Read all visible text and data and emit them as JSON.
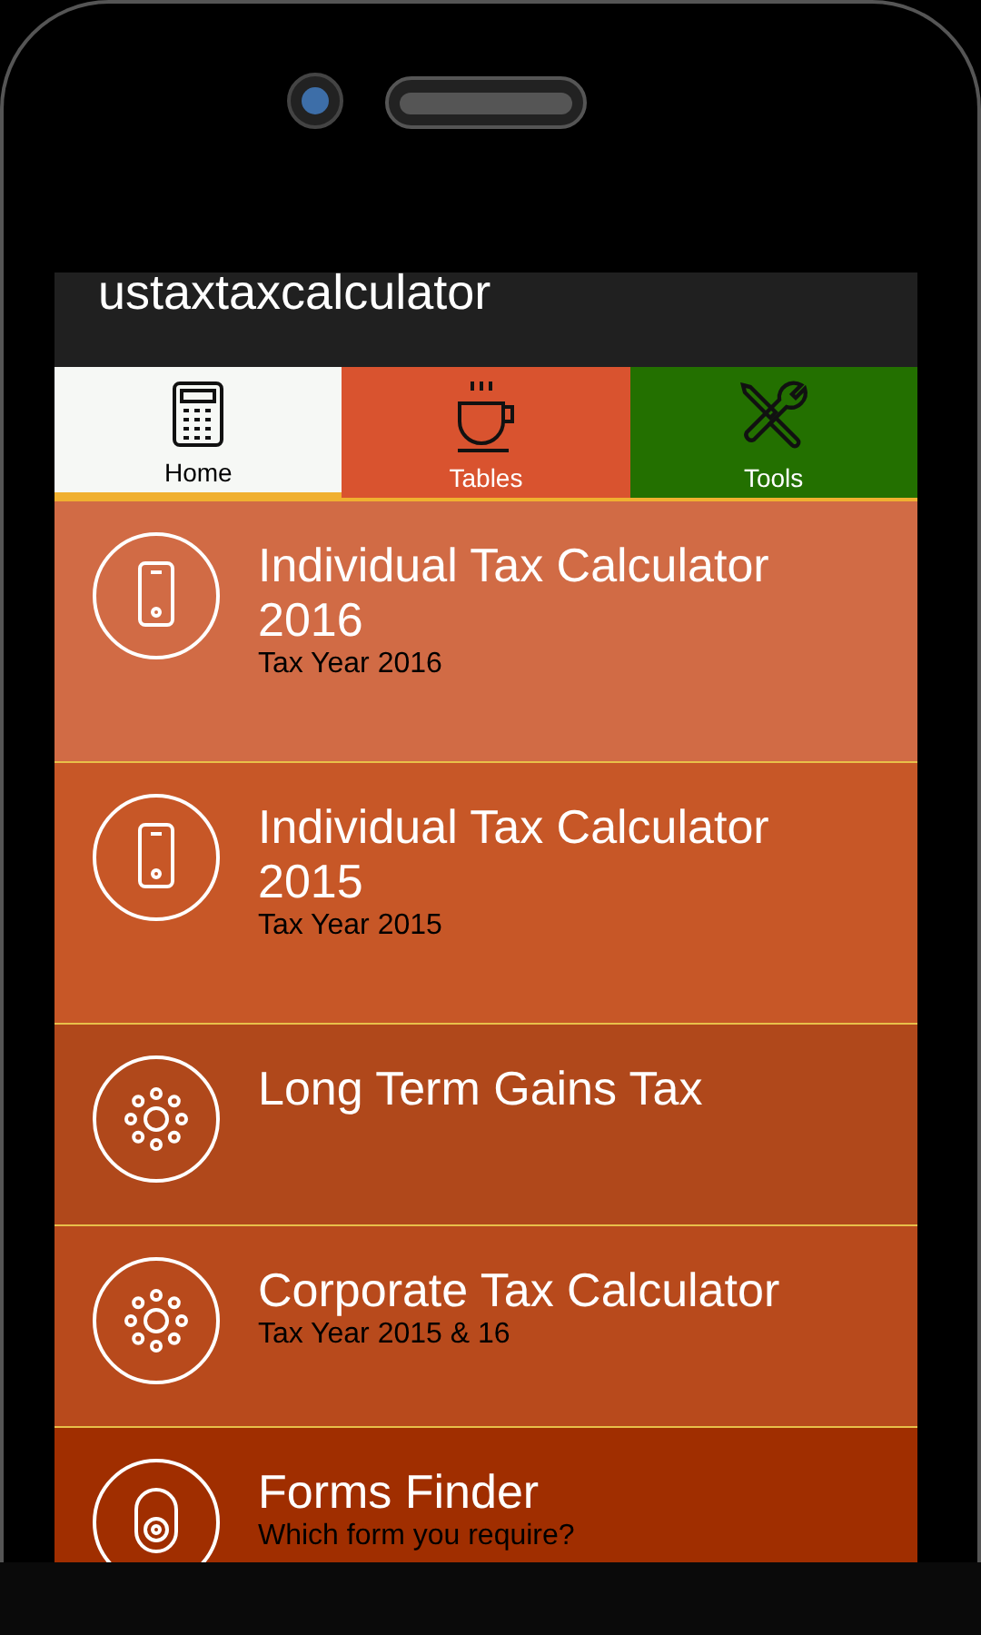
{
  "app_bar": {
    "title": "ustaxtaxcalculator"
  },
  "tabs": [
    {
      "label": "Home",
      "kind": "calculator",
      "selected": true
    },
    {
      "label": "Tables",
      "kind": "cup",
      "selected": false
    },
    {
      "label": "Tools",
      "kind": "tools",
      "selected": false
    }
  ],
  "items": [
    {
      "title": "Individual Tax Calculator 2016",
      "subtitle": "Tax Year 2016",
      "kind": "phone",
      "color": "#d16b45"
    },
    {
      "title": "Individual Tax Calculator 2015",
      "subtitle": "Tax Year 2015",
      "kind": "phone",
      "color": "#c75727"
    },
    {
      "title": "Long Term Gains Tax",
      "kind": "dots",
      "color": "#b0481b"
    },
    {
      "title": "Corporate Tax Calculator",
      "subtitle": "Tax Year 2015 & 16",
      "kind": "dots",
      "color": "#b84a1c"
    },
    {
      "title": "Forms Finder",
      "subtitle": "Which form you require?",
      "kind": "lock",
      "color": "#a02e00"
    }
  ]
}
